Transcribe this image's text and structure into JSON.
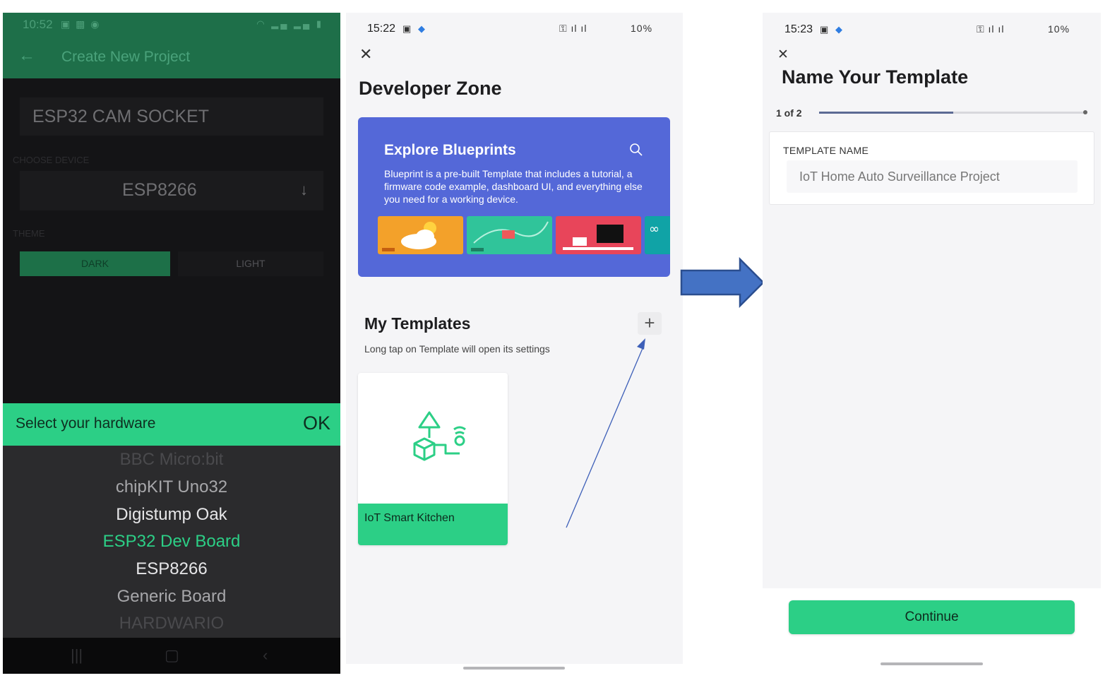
{
  "panel1": {
    "status_time": "10:52",
    "app_title": "Create New Project",
    "project_name": "ESP32 CAM SOCKET",
    "choose_device_label": "CHOOSE DEVICE",
    "device_value": "ESP8266",
    "theme_label": "THEME",
    "theme_dark": "DARK",
    "theme_light": "LIGHT",
    "sheet_title": "Select your hardware",
    "sheet_ok": "OK",
    "hardware_options": [
      "BBC Micro:bit",
      "chipKIT Uno32",
      "Digistump Oak",
      "ESP32 Dev Board",
      "ESP8266",
      "Generic Board",
      "HARDWARIO"
    ],
    "selected_option": "ESP32 Dev Board"
  },
  "panel2": {
    "status_time": "15:22",
    "battery": "10%",
    "heading": "Developer Zone",
    "blueprints_title": "Explore Blueprints",
    "blueprints_desc": "Blueprint is a pre-built Template that includes a tutorial, a firmware code example, dashboard UI, and everything else you need for a working device.",
    "templates_title": "My Templates",
    "templates_hint": "Long tap on Template will open its settings",
    "template_card_name": "IoT Smart Kitchen"
  },
  "panel3": {
    "status_time": "15:23",
    "battery": "10%",
    "heading": "Name Your Template",
    "step_indicator": "1 of 2",
    "progress_fraction": 0.5,
    "field_label": "TEMPLATE NAME",
    "field_value": "IoT Home Auto Surveillance Project",
    "continue_label": "Continue"
  },
  "colors": {
    "accent_green": "#2ccf86",
    "dark_green_bar": "#1e6f49",
    "blueprint_blue": "#5468d8",
    "arrow_blue": "#4472c4"
  }
}
